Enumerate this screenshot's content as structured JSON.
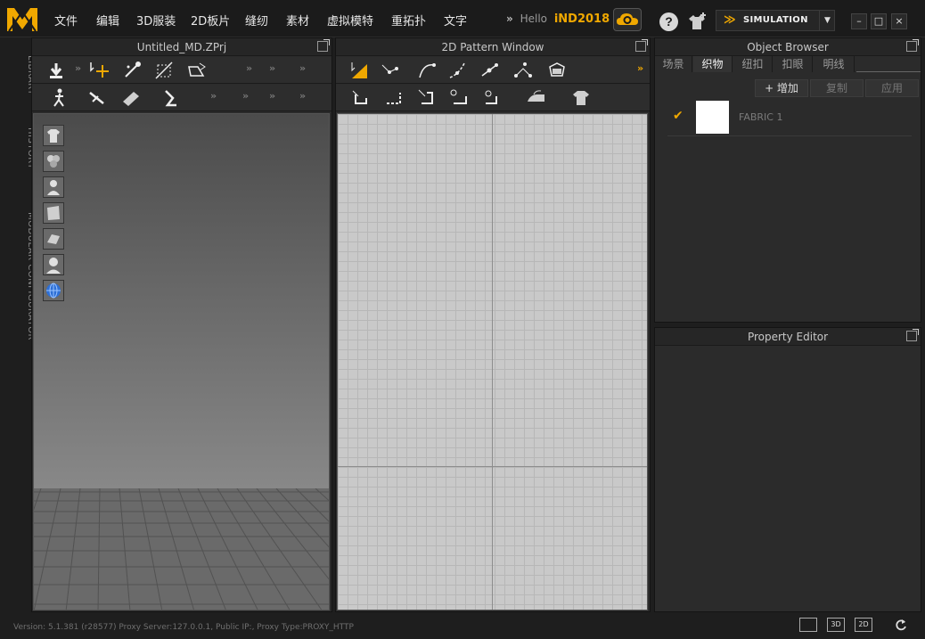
{
  "app": {
    "logo_text": "M",
    "menu": [
      "文件",
      "编辑",
      "3D服装",
      "2D板片",
      "缝纫",
      "素材",
      "虚拟模特",
      "重拓扑",
      "文字"
    ],
    "overflow_label": "»",
    "greeting": "Hello",
    "username": "iND2018",
    "help_label": "?",
    "simulation_label": "SIMULATION",
    "window_controls": {
      "minimize": "–",
      "maximize": "□",
      "close": "×"
    }
  },
  "side_tabs": [
    "LIBRARY",
    "HISTORY",
    "MODULAR CONFIGURATOR"
  ],
  "panel3d": {
    "title": "Untitled_MD.ZPrj",
    "overflow": "»"
  },
  "panel2d": {
    "title": "2D Pattern Window",
    "overflow": "»"
  },
  "object_browser": {
    "title": "Object Browser",
    "tabs": [
      "场景",
      "织物",
      "纽扣",
      "扣眼",
      "明线"
    ],
    "active_tab": "织物",
    "add_label": "+ 增加",
    "copy_label": "复制",
    "apply_label": "应用",
    "fabrics": [
      {
        "name": "FABRIC 1",
        "checked": "✔",
        "color": "#ffffff"
      }
    ]
  },
  "property_editor": {
    "title": "Property Editor"
  },
  "status": {
    "text": "Version: 5.1.381 (r28577)    Proxy Server:127.0.0.1, Public IP:, Proxy Type:PROXY_HTTP",
    "view3d": "3D",
    "view2d": "2D"
  },
  "colors": {
    "accent": "#f0a800",
    "background": "#1e1e1e",
    "panel": "#2b2b2b",
    "grid2d": "#c9c9c9"
  }
}
